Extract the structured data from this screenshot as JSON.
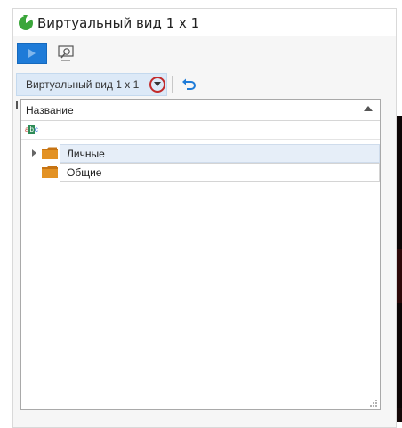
{
  "window": {
    "title": "Виртуальный вид 1 х 1"
  },
  "toolbar": {
    "play_icon": "play-icon",
    "search_icon": "search-window-icon",
    "view_selector": "Виртуальный вид 1 х 1",
    "undo_icon": "undo-icon"
  },
  "tree": {
    "column_header": "Название",
    "sort": "ascending",
    "filter_icon": "abc-filter-icon",
    "items": [
      {
        "label": "Личные",
        "icon": "folder-icon",
        "expandable": true,
        "selected": true
      },
      {
        "label": "Общие",
        "icon": "folder-icon",
        "expandable": false,
        "selected": false
      }
    ]
  },
  "colors": {
    "accent": "#1e7bd8",
    "selector_bg": "#dce9f7",
    "highlight_circle": "#c22a2a",
    "folder": "#d98a1a",
    "selected_row": "#e6eef8"
  }
}
